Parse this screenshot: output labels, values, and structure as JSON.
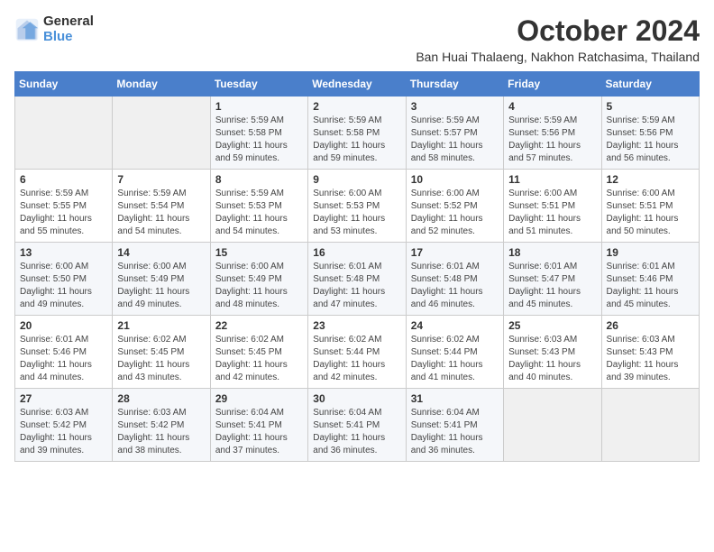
{
  "logo": {
    "general": "General",
    "blue": "Blue"
  },
  "header": {
    "month": "October 2024",
    "subtitle": "Ban Huai Thalaeng, Nakhon Ratchasima, Thailand"
  },
  "weekdays": [
    "Sunday",
    "Monday",
    "Tuesday",
    "Wednesday",
    "Thursday",
    "Friday",
    "Saturday"
  ],
  "weeks": [
    [
      {
        "day": "",
        "info": ""
      },
      {
        "day": "",
        "info": ""
      },
      {
        "day": "1",
        "info": "Sunrise: 5:59 AM\nSunset: 5:58 PM\nDaylight: 11 hours and 59 minutes."
      },
      {
        "day": "2",
        "info": "Sunrise: 5:59 AM\nSunset: 5:58 PM\nDaylight: 11 hours and 59 minutes."
      },
      {
        "day": "3",
        "info": "Sunrise: 5:59 AM\nSunset: 5:57 PM\nDaylight: 11 hours and 58 minutes."
      },
      {
        "day": "4",
        "info": "Sunrise: 5:59 AM\nSunset: 5:56 PM\nDaylight: 11 hours and 57 minutes."
      },
      {
        "day": "5",
        "info": "Sunrise: 5:59 AM\nSunset: 5:56 PM\nDaylight: 11 hours and 56 minutes."
      }
    ],
    [
      {
        "day": "6",
        "info": "Sunrise: 5:59 AM\nSunset: 5:55 PM\nDaylight: 11 hours and 55 minutes."
      },
      {
        "day": "7",
        "info": "Sunrise: 5:59 AM\nSunset: 5:54 PM\nDaylight: 11 hours and 54 minutes."
      },
      {
        "day": "8",
        "info": "Sunrise: 5:59 AM\nSunset: 5:53 PM\nDaylight: 11 hours and 54 minutes."
      },
      {
        "day": "9",
        "info": "Sunrise: 6:00 AM\nSunset: 5:53 PM\nDaylight: 11 hours and 53 minutes."
      },
      {
        "day": "10",
        "info": "Sunrise: 6:00 AM\nSunset: 5:52 PM\nDaylight: 11 hours and 52 minutes."
      },
      {
        "day": "11",
        "info": "Sunrise: 6:00 AM\nSunset: 5:51 PM\nDaylight: 11 hours and 51 minutes."
      },
      {
        "day": "12",
        "info": "Sunrise: 6:00 AM\nSunset: 5:51 PM\nDaylight: 11 hours and 50 minutes."
      }
    ],
    [
      {
        "day": "13",
        "info": "Sunrise: 6:00 AM\nSunset: 5:50 PM\nDaylight: 11 hours and 49 minutes."
      },
      {
        "day": "14",
        "info": "Sunrise: 6:00 AM\nSunset: 5:49 PM\nDaylight: 11 hours and 49 minutes."
      },
      {
        "day": "15",
        "info": "Sunrise: 6:00 AM\nSunset: 5:49 PM\nDaylight: 11 hours and 48 minutes."
      },
      {
        "day": "16",
        "info": "Sunrise: 6:01 AM\nSunset: 5:48 PM\nDaylight: 11 hours and 47 minutes."
      },
      {
        "day": "17",
        "info": "Sunrise: 6:01 AM\nSunset: 5:48 PM\nDaylight: 11 hours and 46 minutes."
      },
      {
        "day": "18",
        "info": "Sunrise: 6:01 AM\nSunset: 5:47 PM\nDaylight: 11 hours and 45 minutes."
      },
      {
        "day": "19",
        "info": "Sunrise: 6:01 AM\nSunset: 5:46 PM\nDaylight: 11 hours and 45 minutes."
      }
    ],
    [
      {
        "day": "20",
        "info": "Sunrise: 6:01 AM\nSunset: 5:46 PM\nDaylight: 11 hours and 44 minutes."
      },
      {
        "day": "21",
        "info": "Sunrise: 6:02 AM\nSunset: 5:45 PM\nDaylight: 11 hours and 43 minutes."
      },
      {
        "day": "22",
        "info": "Sunrise: 6:02 AM\nSunset: 5:45 PM\nDaylight: 11 hours and 42 minutes."
      },
      {
        "day": "23",
        "info": "Sunrise: 6:02 AM\nSunset: 5:44 PM\nDaylight: 11 hours and 42 minutes."
      },
      {
        "day": "24",
        "info": "Sunrise: 6:02 AM\nSunset: 5:44 PM\nDaylight: 11 hours and 41 minutes."
      },
      {
        "day": "25",
        "info": "Sunrise: 6:03 AM\nSunset: 5:43 PM\nDaylight: 11 hours and 40 minutes."
      },
      {
        "day": "26",
        "info": "Sunrise: 6:03 AM\nSunset: 5:43 PM\nDaylight: 11 hours and 39 minutes."
      }
    ],
    [
      {
        "day": "27",
        "info": "Sunrise: 6:03 AM\nSunset: 5:42 PM\nDaylight: 11 hours and 39 minutes."
      },
      {
        "day": "28",
        "info": "Sunrise: 6:03 AM\nSunset: 5:42 PM\nDaylight: 11 hours and 38 minutes."
      },
      {
        "day": "29",
        "info": "Sunrise: 6:04 AM\nSunset: 5:41 PM\nDaylight: 11 hours and 37 minutes."
      },
      {
        "day": "30",
        "info": "Sunrise: 6:04 AM\nSunset: 5:41 PM\nDaylight: 11 hours and 36 minutes."
      },
      {
        "day": "31",
        "info": "Sunrise: 6:04 AM\nSunset: 5:41 PM\nDaylight: 11 hours and 36 minutes."
      },
      {
        "day": "",
        "info": ""
      },
      {
        "day": "",
        "info": ""
      }
    ]
  ]
}
